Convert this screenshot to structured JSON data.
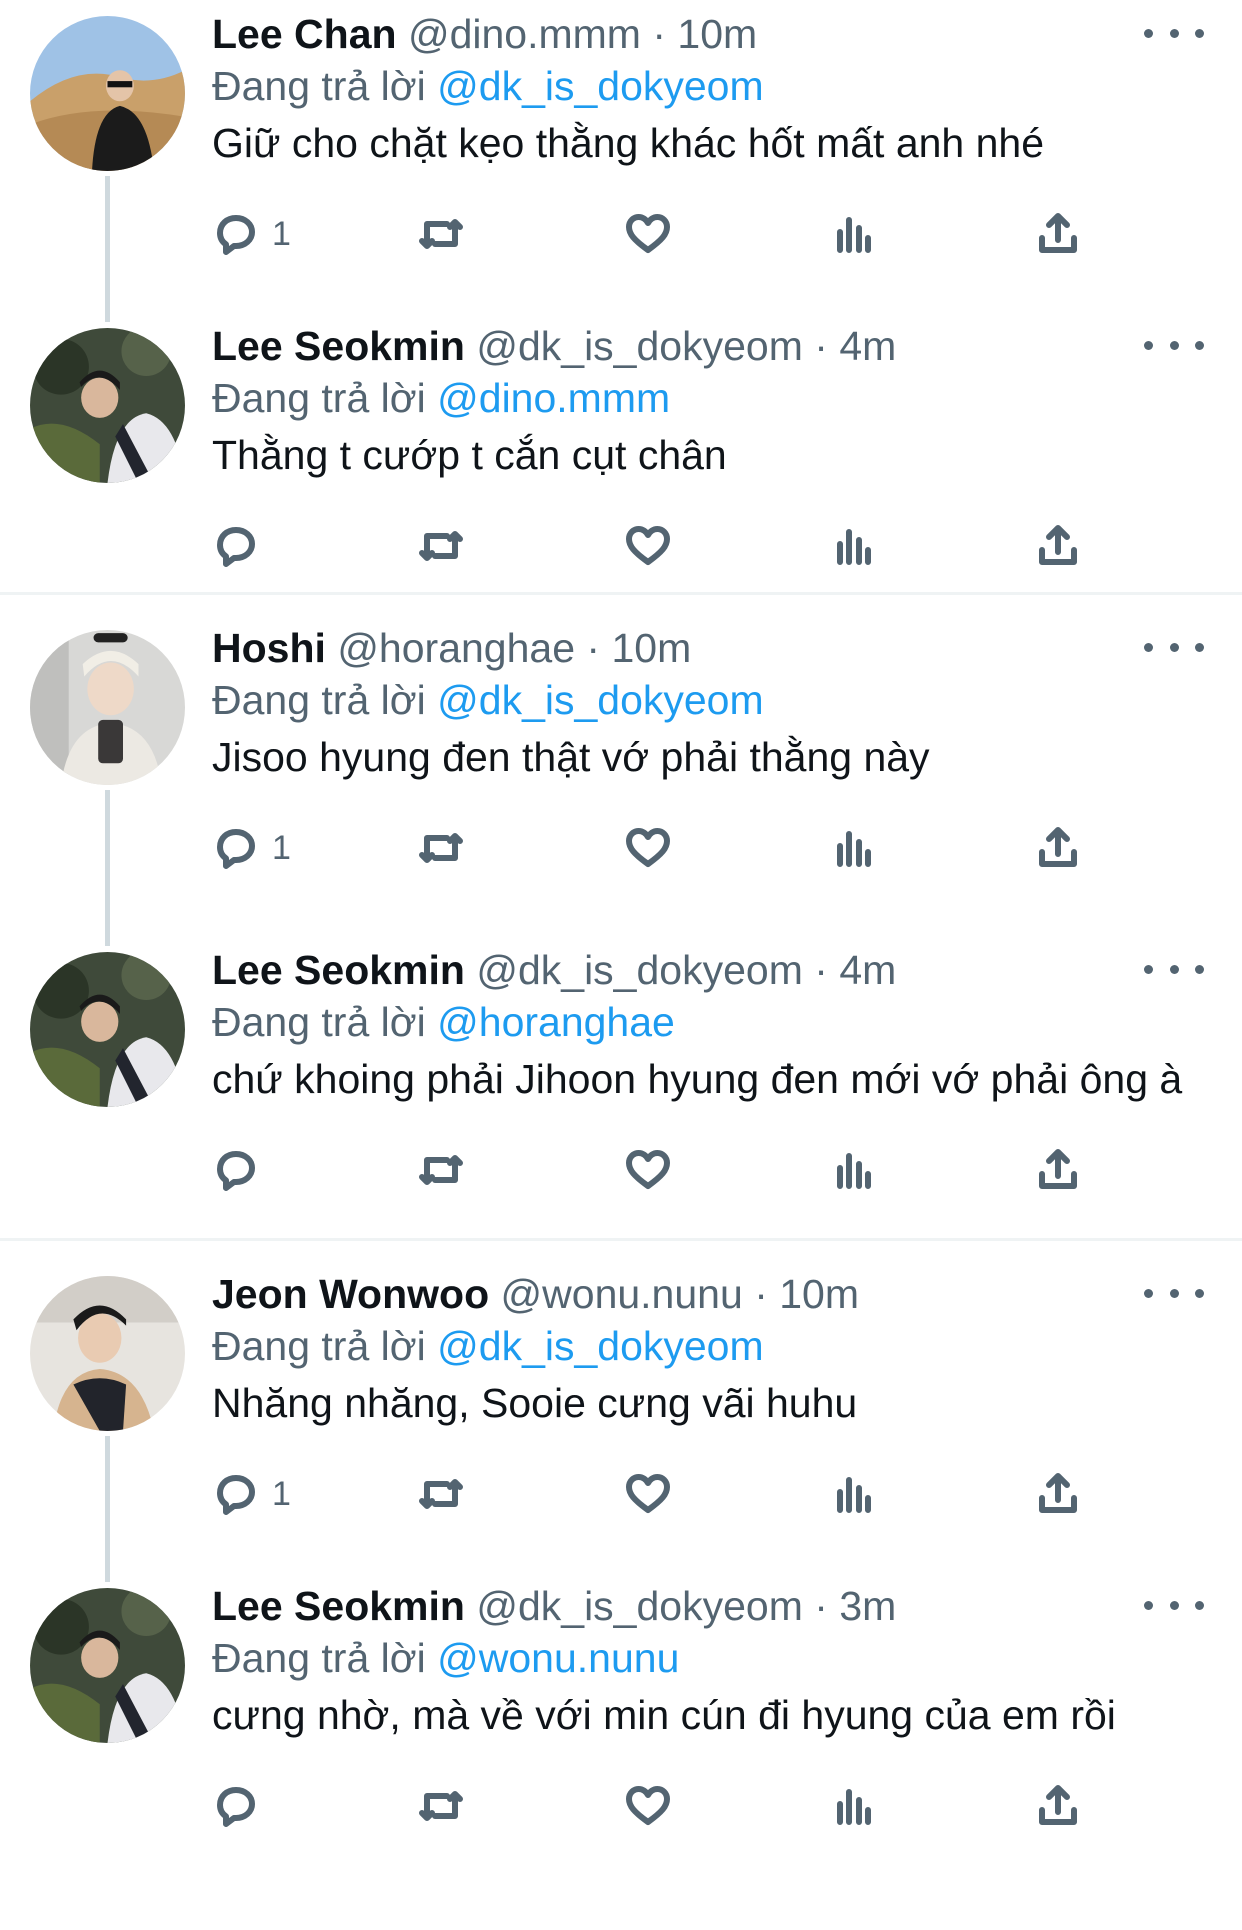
{
  "colors": {
    "accent": "#1d9bf0",
    "text": "#0f1419",
    "muted": "#536471",
    "line": "#cfd9de"
  },
  "icons": {
    "reply": "reply-icon",
    "retweet": "retweet-icon",
    "like": "heart-icon",
    "views": "views-icon",
    "share": "share-icon",
    "more": "more-icon"
  },
  "threads": [
    {
      "tweets": [
        {
          "name": "Lee Chan",
          "handle": "@dino.mmm",
          "sep": "·",
          "time": "10m",
          "replying_prefix": "Đang trả lời ",
          "replying_to": "@dk_is_dokyeom",
          "text": "Giữ cho chặt kẹo thằng khác hốt mất anh nhé",
          "reply_count": "1"
        },
        {
          "name": "Lee Seokmin",
          "handle": "@dk_is_dokyeom",
          "sep": "·",
          "time": "4m",
          "replying_prefix": "Đang trả lời ",
          "replying_to": "@dino.mmm",
          "text": "Thằng t cướp t cắn cụt chân",
          "reply_count": ""
        }
      ]
    },
    {
      "tweets": [
        {
          "name": "Hoshi",
          "handle": "@horanghae",
          "sep": "·",
          "time": "10m",
          "replying_prefix": "Đang trả lời ",
          "replying_to": "@dk_is_dokyeom",
          "text": "Jisoo hyung đen thật vớ phải thằng này",
          "reply_count": "1"
        },
        {
          "name": "Lee Seokmin",
          "handle": "@dk_is_dokyeom",
          "sep": "·",
          "time": "4m",
          "replying_prefix": "Đang trả lời ",
          "replying_to": "@horanghae",
          "text": "chứ khoing phải Jihoon hyung đen mới vớ phải ông à",
          "reply_count": ""
        }
      ]
    },
    {
      "tweets": [
        {
          "name": "Jeon Wonwoo",
          "handle": "@wonu.nunu",
          "sep": "·",
          "time": "10m",
          "replying_prefix": "Đang trả lời ",
          "replying_to": "@dk_is_dokyeom",
          "text": "Nhăng nhăng, Sooie cưng vãi huhu",
          "reply_count": "1"
        },
        {
          "name": "Lee Seokmin",
          "handle": "@dk_is_dokyeom",
          "sep": "·",
          "time": "3m",
          "replying_prefix": "Đang trả lời ",
          "replying_to": "@wonu.nunu",
          "text": "cưng nhờ, mà về với min cún đi hyung của em rồi",
          "reply_count": ""
        }
      ]
    }
  ]
}
